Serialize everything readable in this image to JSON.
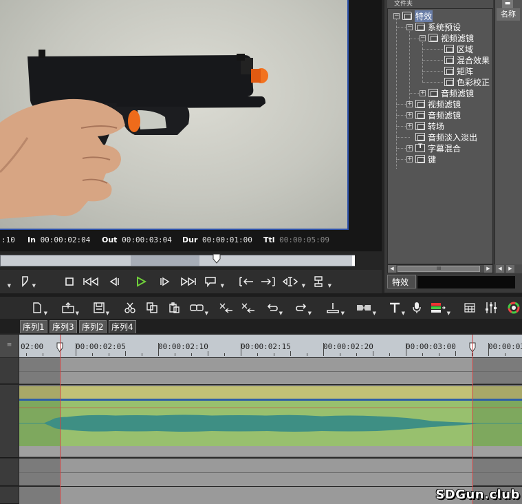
{
  "preview": {
    "timecodes": {
      "current_partial": ":10",
      "in_label": "In",
      "in_value": "00:00:02:04",
      "out_label": "Out",
      "out_value": "00:00:03:04",
      "dur_label": "Dur",
      "dur_value": "00:00:01:00",
      "ttl_label": "Ttl",
      "ttl_value": "00:00:05:09"
    },
    "playhead_fraction": 0.6
  },
  "effects_panel": {
    "folder_header": "文件夹",
    "name_column": "名称",
    "tree": {
      "root": "特效",
      "system_presets": "系统预设",
      "video_filters_sub": "视频滤镜",
      "region": "区域",
      "blend": "混合效果",
      "matrix": "矩阵",
      "color_correct": "色彩校正",
      "audio_filters_sub": "音频滤镜",
      "video_filters": "视频滤镜",
      "audio_filters": "音频滤镜",
      "transitions": "转场",
      "audio_fade": "音频淡入淡出",
      "title_mix": "字幕混合",
      "keys": "键"
    },
    "scroll_thumb": "III",
    "bottom_tab": "特效"
  },
  "sequence_tabs": [
    "序列1",
    "序列3",
    "序列2",
    "序列4"
  ],
  "active_sequence_tab": "序列4",
  "ruler": {
    "labels": [
      "02:00",
      "00:00:02:05",
      "00:00:02:10",
      "00:00:02:15",
      "00:00:02:20",
      "00:00:03:00",
      "00:00:03"
    ]
  },
  "watermark": "SDGun.club",
  "colors": {
    "timeline_green": "#98c06e",
    "timeline_yellow": "#c2c176",
    "waveform": "#3e8f84",
    "in_out_line": "#c44444",
    "play_green": "#6fcf3a",
    "selection_blue": "#6a7ea8"
  }
}
